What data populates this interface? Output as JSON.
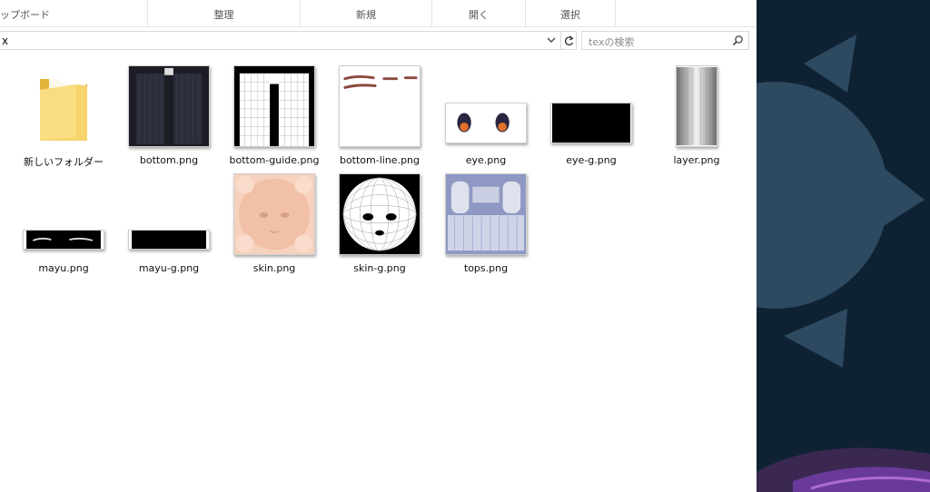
{
  "ribbon": {
    "clipboard": "ップボード",
    "organize": "整理",
    "new": "新規",
    "open": "開く",
    "select": "選択"
  },
  "address": {
    "path": "x",
    "search_placeholder": "texの検索"
  },
  "files": [
    {
      "name": "新しいフォルダー",
      "icon": "folder-icon"
    },
    {
      "name": "bottom.png"
    },
    {
      "name": "bottom-guide.png"
    },
    {
      "name": "bottom-line.png"
    },
    {
      "name": "eye.png"
    },
    {
      "name": "eye-g.png"
    },
    {
      "name": "layer.png"
    },
    {
      "name": "mayu.png"
    },
    {
      "name": "mayu-g.png"
    },
    {
      "name": "skin.png"
    },
    {
      "name": "skin-g.png"
    },
    {
      "name": "tops.png"
    }
  ],
  "colors": {
    "folder": "#f2c94c",
    "skin": "#f4c6ae",
    "tops": "#8e98c2",
    "desktop": "#0f2233"
  }
}
